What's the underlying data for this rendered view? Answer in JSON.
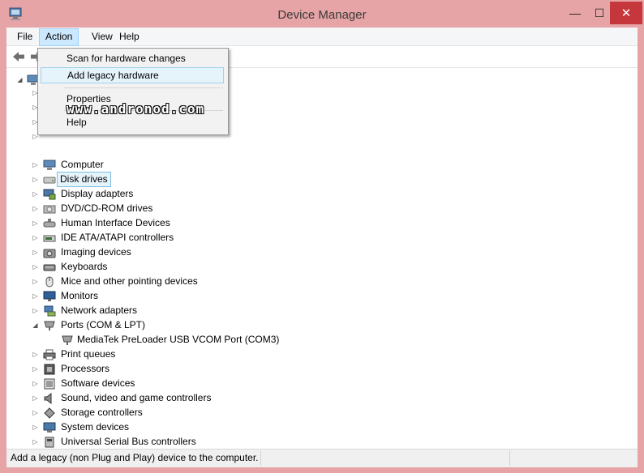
{
  "window": {
    "title": "Device Manager",
    "minimize": "—",
    "maximize": "☐",
    "close": "✕"
  },
  "menubar": {
    "items": [
      "File",
      "Action",
      "View",
      "Help"
    ],
    "active": "Action"
  },
  "toolbar": {
    "buttons": [
      "back-icon",
      "forward-icon"
    ]
  },
  "action_menu": {
    "items": [
      "Scan for hardware changes",
      "Add legacy hardware",
      "Properties",
      "Help"
    ],
    "highlighted": "Add legacy hardware"
  },
  "watermark": "www.andronod.com",
  "tree": {
    "nodes": [
      {
        "label": "Computer",
        "icon": "computer-icon",
        "expanded": false
      },
      {
        "label": "Disk drives",
        "icon": "disk-drive-icon",
        "expanded": false,
        "selected": true
      },
      {
        "label": "Display adapters",
        "icon": "display-adapter-icon",
        "expanded": false
      },
      {
        "label": "DVD/CD-ROM drives",
        "icon": "dvd-drive-icon",
        "expanded": false
      },
      {
        "label": "Human Interface Devices",
        "icon": "hid-icon",
        "expanded": false
      },
      {
        "label": "IDE ATA/ATAPI controllers",
        "icon": "ide-controller-icon",
        "expanded": false
      },
      {
        "label": "Imaging devices",
        "icon": "camera-icon",
        "expanded": false
      },
      {
        "label": "Keyboards",
        "icon": "keyboard-icon",
        "expanded": false
      },
      {
        "label": "Mice and other pointing devices",
        "icon": "mouse-icon",
        "expanded": false
      },
      {
        "label": "Monitors",
        "icon": "monitor-icon",
        "expanded": false
      },
      {
        "label": "Network adapters",
        "icon": "network-adapter-icon",
        "expanded": false
      },
      {
        "label": "Ports (COM & LPT)",
        "icon": "port-icon",
        "expanded": true
      },
      {
        "label": "MediaTek PreLoader USB VCOM Port (COM3)",
        "icon": "port-device-icon",
        "child": true
      },
      {
        "label": "Print queues",
        "icon": "printer-icon",
        "expanded": false
      },
      {
        "label": "Processors",
        "icon": "processor-icon",
        "expanded": false
      },
      {
        "label": "Software devices",
        "icon": "software-device-icon",
        "expanded": false
      },
      {
        "label": "Sound, video and game controllers",
        "icon": "speaker-icon",
        "expanded": false
      },
      {
        "label": "Storage controllers",
        "icon": "storage-controller-icon",
        "expanded": false
      },
      {
        "label": "System devices",
        "icon": "system-device-icon",
        "expanded": false
      },
      {
        "label": "Universal Serial Bus controllers",
        "icon": "usb-icon",
        "expanded": false
      }
    ]
  },
  "statusbar": {
    "text": "Add a legacy (non Plug and Play) device to the computer."
  },
  "colors": {
    "frame": "#e6a4a6",
    "close_button": "#c5373c",
    "menu_highlight": "#cce8ff",
    "selection": "#e5f3fb"
  }
}
